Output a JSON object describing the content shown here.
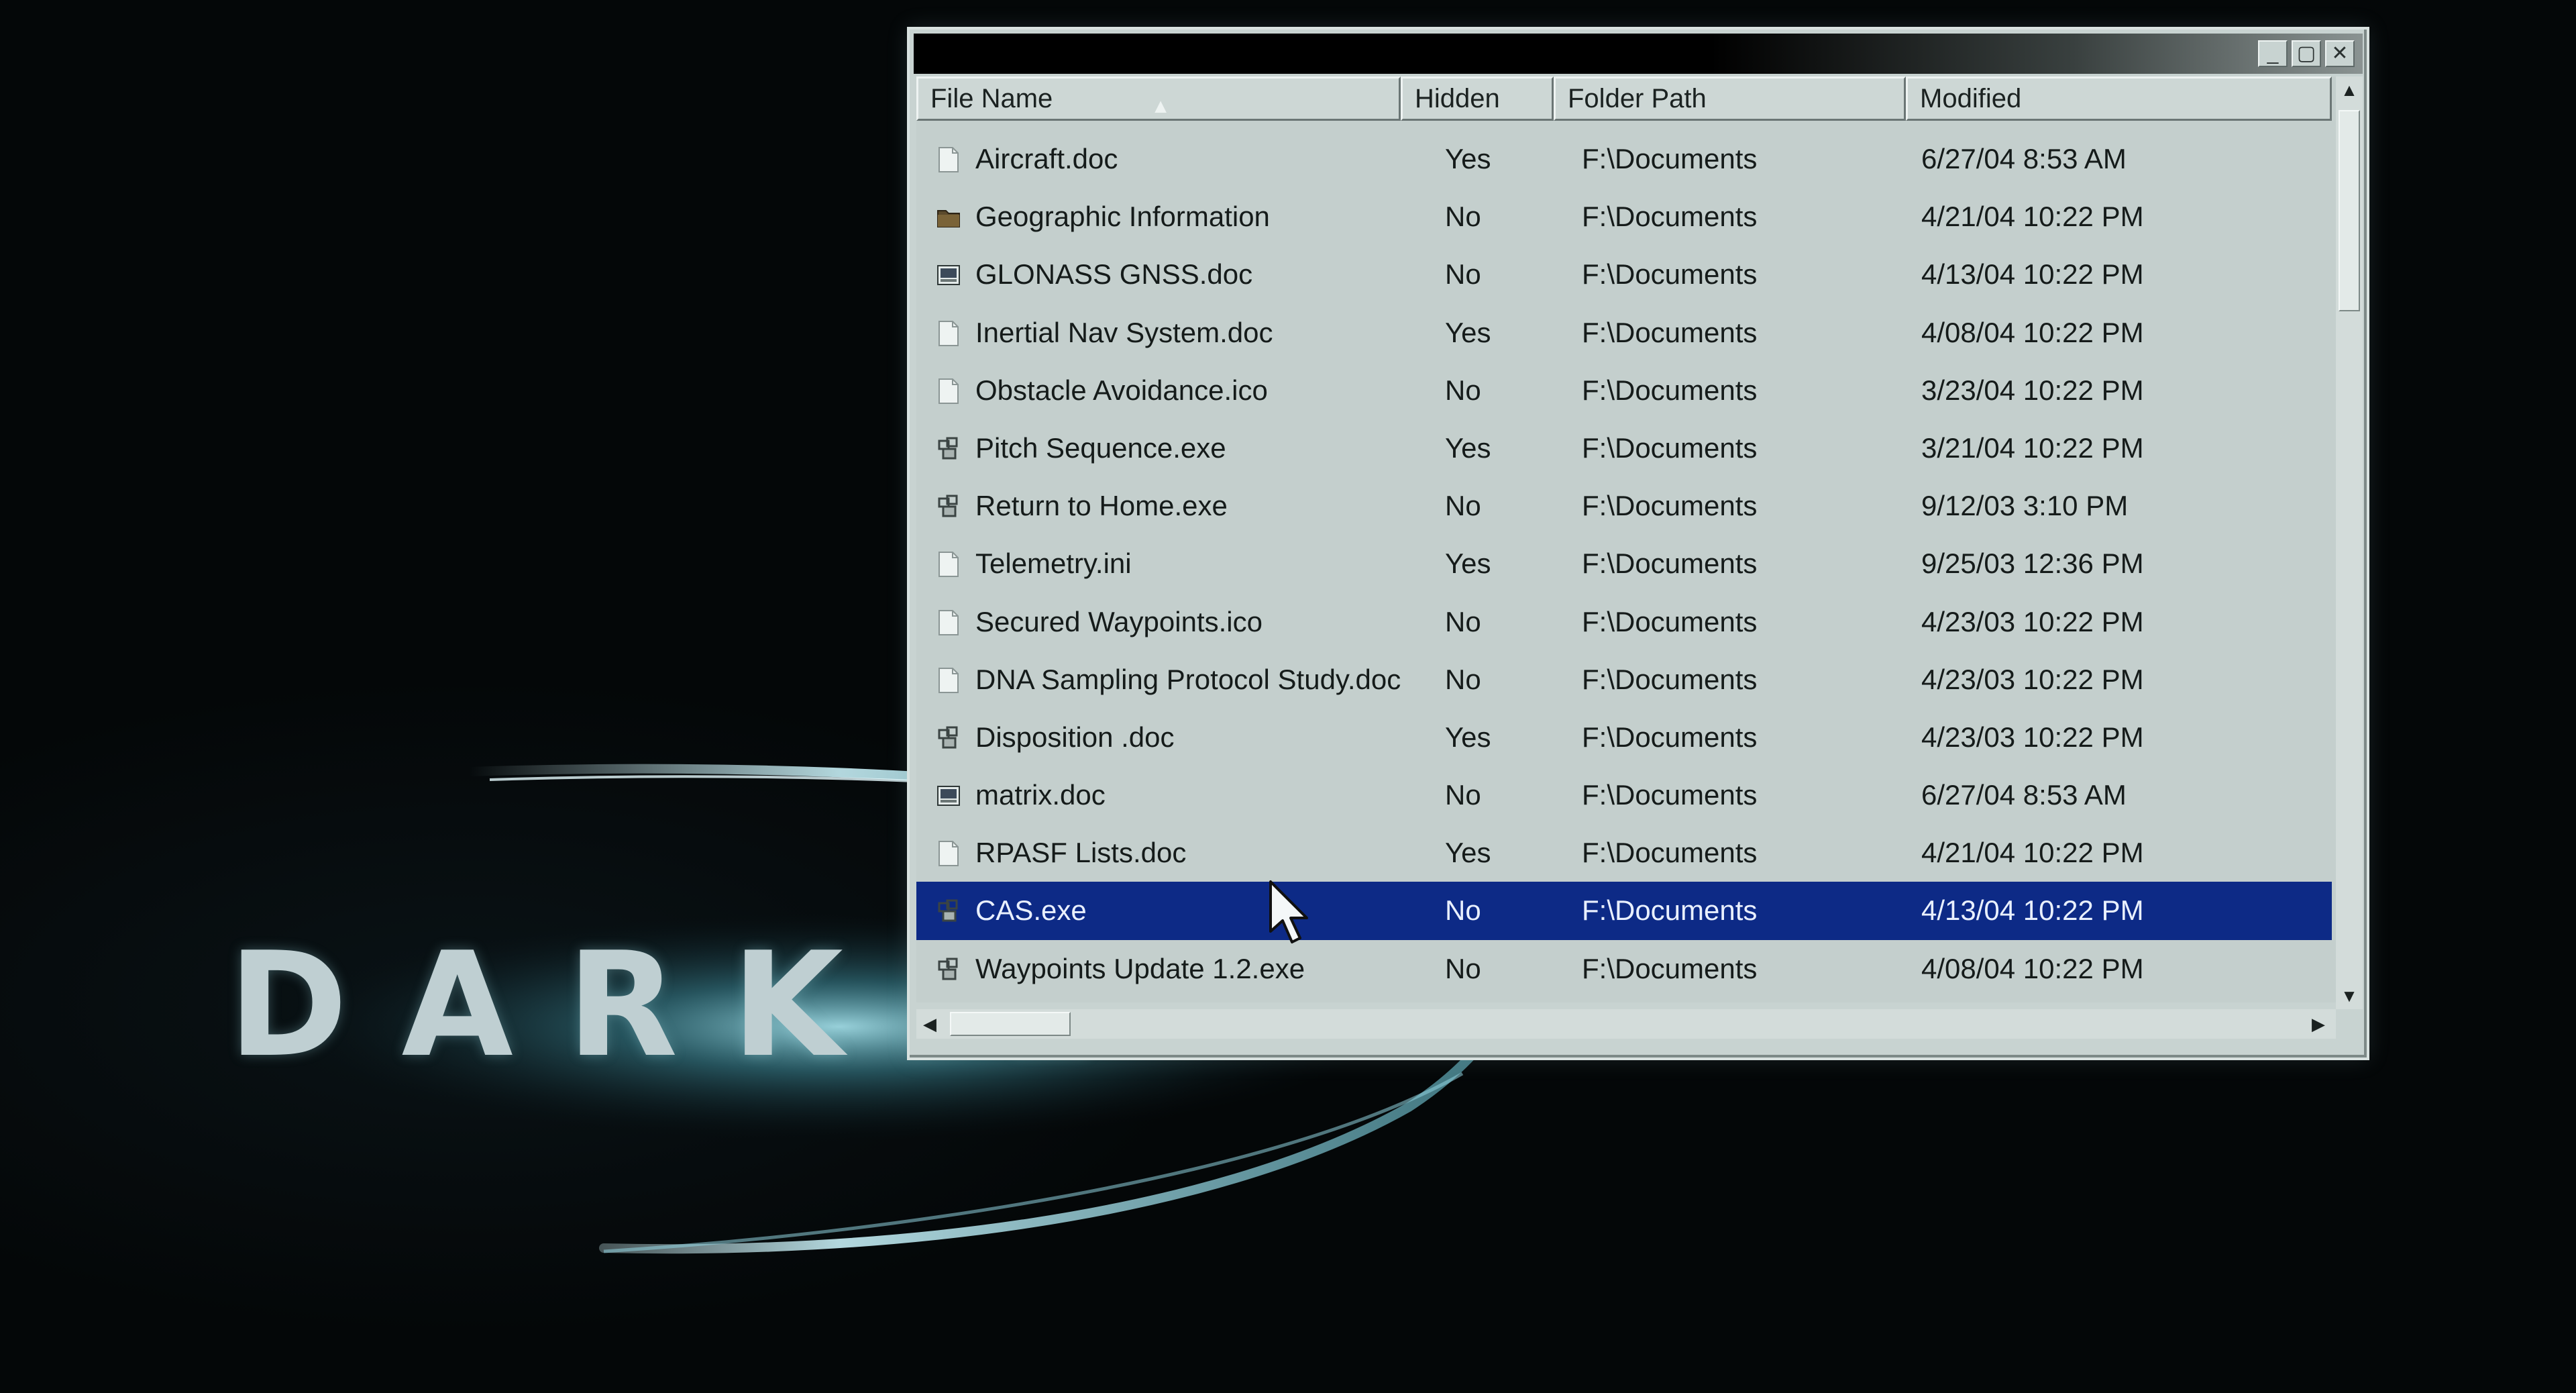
{
  "wallpaper": {
    "logo_text": "DARK L"
  },
  "window": {
    "controls": {
      "minimize": "_",
      "maximize": "▢",
      "close": "✕"
    },
    "columns": [
      "File Name",
      "Hidden",
      "Folder Path",
      "Modified"
    ],
    "sort_column": "File Name",
    "sort_indicator": "▲",
    "files": [
      {
        "name": "Aircraft.doc",
        "hidden": "Yes",
        "path": "F:\\Documents",
        "modified": "6/27/04 8:53 AM",
        "icon": "document-icon"
      },
      {
        "name": "Geographic Information",
        "hidden": "No",
        "path": "F:\\Documents",
        "modified": "4/21/04 10:22 PM",
        "icon": "folder-icon"
      },
      {
        "name": "GLONASS GNSS.doc",
        "hidden": "No",
        "path": "F:\\Documents",
        "modified": "4/13/04 10:22 PM",
        "icon": "image-document-icon"
      },
      {
        "name": "Inertial Nav System.doc",
        "hidden": "Yes",
        "path": "F:\\Documents",
        "modified": "4/08/04 10:22 PM",
        "icon": "document-icon"
      },
      {
        "name": "Obstacle Avoidance.ico",
        "hidden": "No",
        "path": "F:\\Documents",
        "modified": "3/23/04 10:22 PM",
        "icon": "document-icon"
      },
      {
        "name": "Pitch Sequence.exe",
        "hidden": "Yes",
        "path": "F:\\Documents",
        "modified": "3/21/04 10:22 PM",
        "icon": "executable-icon"
      },
      {
        "name": "Return to Home.exe",
        "hidden": "No",
        "path": "F:\\Documents",
        "modified": "9/12/03 3:10 PM",
        "icon": "executable-icon"
      },
      {
        "name": "Telemetry.ini",
        "hidden": "Yes",
        "path": "F:\\Documents",
        "modified": "9/25/03 12:36 PM",
        "icon": "document-icon"
      },
      {
        "name": "Secured Waypoints.ico",
        "hidden": "No",
        "path": "F:\\Documents",
        "modified": "4/23/03 10:22 PM",
        "icon": "document-icon"
      },
      {
        "name": "DNA Sampling Protocol Study.doc",
        "hidden": "No",
        "path": "F:\\Documents",
        "modified": "4/23/03 10:22 PM",
        "icon": "document-icon"
      },
      {
        "name": "Disposition .doc",
        "hidden": "Yes",
        "path": "F:\\Documents",
        "modified": "4/23/03 10:22 PM",
        "icon": "executable-icon"
      },
      {
        "name": "matrix.doc",
        "hidden": "No",
        "path": "F:\\Documents",
        "modified": "6/27/04 8:53 AM",
        "icon": "image-document-icon"
      },
      {
        "name": "RPASF Lists.doc",
        "hidden": "Yes",
        "path": "F:\\Documents",
        "modified": "4/21/04 10:22 PM",
        "icon": "document-icon"
      },
      {
        "name": "CAS.exe",
        "hidden": "No",
        "path": "F:\\Documents",
        "modified": "4/13/04 10:22 PM",
        "icon": "executable-icon",
        "selected": true
      },
      {
        "name": "Waypoints Update 1.2.exe",
        "hidden": "No",
        "path": "F:\\Documents",
        "modified": "4/08/04 10:22 PM",
        "icon": "executable-icon"
      }
    ],
    "scrollbars": {
      "up": "▲",
      "down": "▼",
      "left": "◀",
      "right": "▶"
    }
  },
  "colors": {
    "selection": "#0d2a86",
    "window_face": "#c8d3d1",
    "desktop": "#040708"
  }
}
